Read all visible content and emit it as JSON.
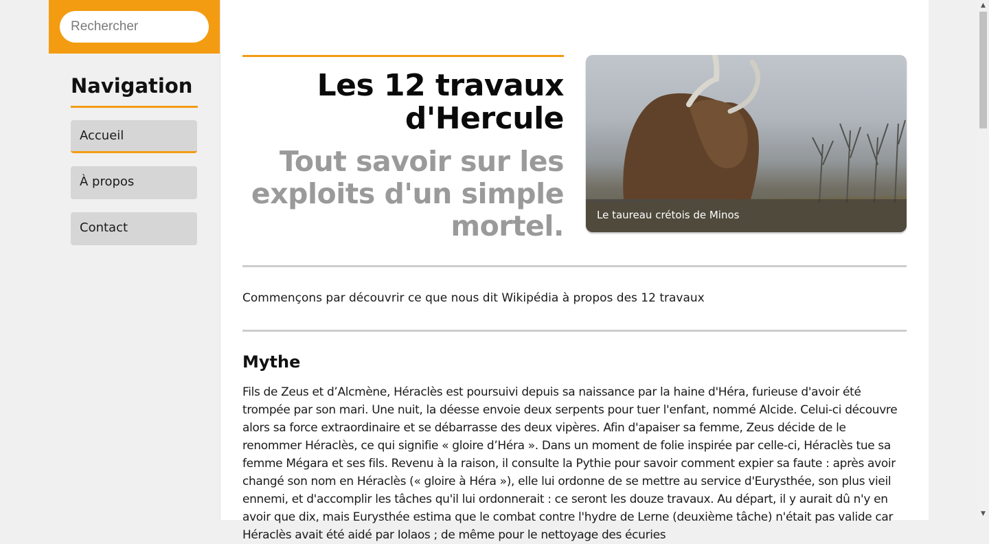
{
  "search": {
    "placeholder": "Rechercher"
  },
  "sidebar": {
    "title": "Navigation",
    "items": [
      {
        "label": "Accueil"
      },
      {
        "label": "À propos"
      },
      {
        "label": "Contact"
      }
    ]
  },
  "hero": {
    "title": "Les 12 travaux d'Hercule",
    "subtitle": "Tout savoir sur les exploits d'un simple mortel.",
    "image_caption": "Le taureau crétois de Minos"
  },
  "content": {
    "intro": "Commençons par découvrir ce que nous dit Wikipédia à propos des 12 travaux",
    "section_title": "Mythe",
    "paragraph": "Fils de Zeus et d’Alcmène, Héraclès est poursuivi depuis sa naissance par la haine d'Héra, furieuse d'avoir été trompée par son mari. Une nuit, la déesse envoie deux serpents pour tuer l'enfant, nommé Alcide. Celui-ci découvre alors sa force extraordinaire et se débarrasse des deux vipères. Afin d'apaiser sa femme, Zeus décide de le renommer Héraclès, ce qui signifie « gloire d’Héra ». Dans un moment de folie inspirée par celle-ci, Héraclès tue sa femme Mégara et ses fils. Revenu à la raison, il consulte la Pythie pour savoir comment expier sa faute : après avoir changé son nom en Héraclès (« gloire à Héra »), elle lui ordonne de se mettre au service d'Eurysthée, son plus vieil ennemi, et d'accomplir les tâches qu'il lui ordonnerait : ce seront les douze travaux. Au départ, il y aurait dû n'y en avoir que dix, mais Eurysthée estima que le combat contre l'hydre de Lerne (deuxième tâche) n'était pas valide car Héraclès avait été aidé par Iolaos ; de même pour le nettoyage des écuries"
  },
  "colors": {
    "accent": "#f39c12",
    "nav_bg": "#d6d6d6",
    "subtitle": "#9a9a9a"
  }
}
